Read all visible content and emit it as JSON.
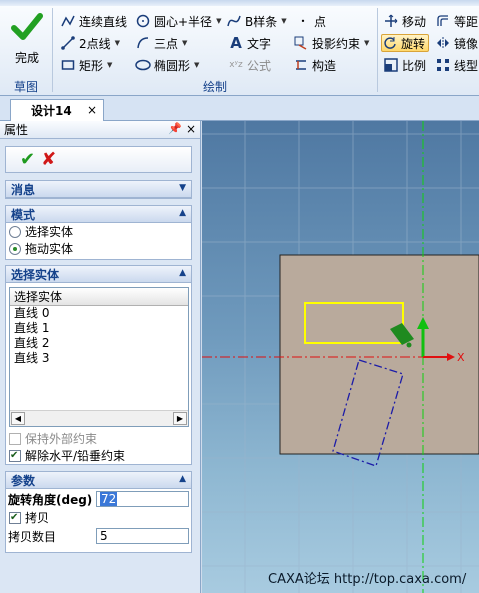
{
  "ribbon": {
    "finish": {
      "label": "完成",
      "icon": "check-icon"
    },
    "groups": {
      "sketch": "草图",
      "draw": "绘制"
    },
    "draw_tools": [
      {
        "label": "连续直线",
        "icon": "polyline-icon"
      },
      {
        "label": "2点线",
        "icon": "two-point-line-icon"
      },
      {
        "label": "矩形",
        "icon": "rectangle-icon"
      },
      {
        "label": "圆心+半径",
        "icon": "circle-icon"
      },
      {
        "label": "三点",
        "icon": "three-point-arc-icon"
      },
      {
        "label": "椭圆形",
        "icon": "ellipse-icon"
      },
      {
        "label": "B样条",
        "icon": "spline-icon"
      },
      {
        "label": "文字",
        "icon": "text-icon"
      },
      {
        "label": "公式",
        "icon": "formula-icon"
      },
      {
        "label": "点",
        "icon": "point-icon"
      },
      {
        "label": "投影约束",
        "icon": "project-constraint-icon"
      },
      {
        "label": "构造",
        "icon": "construct-icon"
      }
    ],
    "edit_tools": [
      {
        "label": "移动",
        "icon": "move-icon"
      },
      {
        "label": "旋转",
        "icon": "rotate-icon"
      },
      {
        "label": "比例",
        "icon": "scale-icon"
      },
      {
        "label": "等距",
        "icon": "offset-icon"
      },
      {
        "label": "镜像",
        "icon": "mirror-icon"
      },
      {
        "label": "线型阵",
        "icon": "linear-array-icon"
      }
    ]
  },
  "tabs": {
    "doc_tab": "设计14",
    "close": "×"
  },
  "panel": {
    "title": "属性",
    "pin": "ᅟ",
    "close": "×",
    "ok": "✔",
    "cancel": "✘",
    "sections": {
      "message": {
        "title": "消息"
      },
      "mode": {
        "title": "模式",
        "options": [
          {
            "label": "选择实体",
            "selected": false
          },
          {
            "label": "拖动实体",
            "selected": true
          }
        ]
      },
      "select": {
        "title": "选择实体",
        "list_header": "选择实体",
        "items": [
          "直线 0",
          "直线 1",
          "直线 2",
          "直线 3"
        ],
        "keep_external": {
          "label": "保持外部约束",
          "checked": false,
          "enabled": false
        },
        "release_hv": {
          "label": "解除水平/铅垂约束",
          "checked": true
        }
      },
      "params": {
        "title": "参数",
        "angle_label": "旋转角度(deg)",
        "angle_value": "72",
        "copy_label": "拷贝",
        "copy_checked": true,
        "count_label": "拷贝数目",
        "count_value": "5"
      }
    }
  },
  "canvas": {
    "axis_x_label": "X",
    "watermark": "CAXA论坛 http://top.caxa.com/",
    "colors": {
      "axis_x": "#e01010",
      "axis_y": "#10d010",
      "plate": "#b9aa9c",
      "selected": "#ffff00",
      "preview": "#1c1ca8"
    }
  }
}
